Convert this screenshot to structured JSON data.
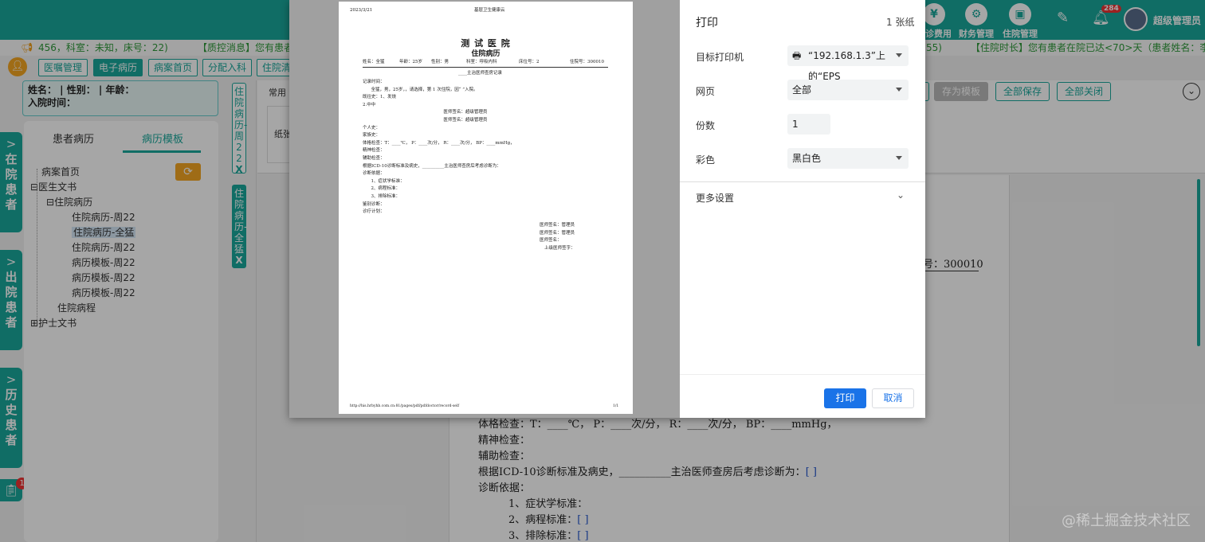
{
  "topbar": {
    "icons": [
      {
        "label": "门诊费用",
        "glyph": "¥",
        "icon": "yen-icon"
      },
      {
        "label": "财务管理",
        "glyph": "⚙",
        "icon": "gear-icon"
      },
      {
        "label": "住院管理",
        "glyph": "▣",
        "icon": "bed-icon"
      }
    ],
    "notify_count": "284",
    "user_name": "超级管理员"
  },
  "ticker": {
    "count": "456，科室：未知，床号：22)",
    "message": "【质控消息】您有患者",
    "mid": "55)",
    "message_right": "【住院时长】您有患者在院已达<70>天（患者姓名：李"
  },
  "nav": {
    "buttons": [
      "医嘱管理",
      "电子病历",
      "病案首页",
      "分配入科",
      "住院清"
    ],
    "active_index": 1
  },
  "patient": {
    "line1": "姓名：  | 性别：  | 年龄：",
    "line2": "入院时间："
  },
  "leftpanel": {
    "tabs": [
      "患者病历",
      "病历模板"
    ],
    "active_tab": 1,
    "tree": [
      {
        "label": "病案首页",
        "prefix": "",
        "level": 0
      },
      {
        "label": "医生文书",
        "prefix": "⊟",
        "level": 0
      },
      {
        "label": "住院病历",
        "prefix": "⊟",
        "level": 1
      },
      {
        "label": "住院病历-周22",
        "prefix": "",
        "level": 2
      },
      {
        "label": "住院病历-全猛",
        "prefix": "",
        "level": 2,
        "selected": true
      },
      {
        "label": "住院病历-周22",
        "prefix": "",
        "level": 2
      },
      {
        "label": "病历模板-周22",
        "prefix": "",
        "level": 2
      },
      {
        "label": "病历模板-周22",
        "prefix": "",
        "level": 2
      },
      {
        "label": "病历模板-周22",
        "prefix": "",
        "level": 2
      },
      {
        "label": "住院病程",
        "prefix": "",
        "level": 1
      },
      {
        "label": "护士文书",
        "prefix": "⊞",
        "level": 0
      }
    ]
  },
  "sidetabs": [
    {
      "label": "在院患者"
    },
    {
      "label": "出院患者"
    },
    {
      "label": "历史患者"
    }
  ],
  "sidebadge": "1",
  "vtabs": [
    {
      "label": "住院病历-周22",
      "close": "X"
    },
    {
      "label": "住院病历-全猛",
      "close": "X"
    }
  ],
  "toolbar": {
    "common": "常用",
    "paper_label": "纸张",
    "buttons": [
      "存为模板",
      "全部保存",
      "全部关闭"
    ]
  },
  "document": {
    "bed_no": "号：300010",
    "lines": [
      {
        "text": "体格检查：T：____℃， P：____次/分， R：____次/分， BP：____mmHg，",
        "indent": 0
      },
      {
        "text": "精神检查：",
        "indent": 0
      },
      {
        "text": "辅助检查：",
        "indent": 0
      },
      {
        "text": "根据ICD-10诊断标准及病史，__________主治医师查房后考虑诊断为：",
        "indent": 0,
        "blue": "[ ]"
      },
      {
        "text": "诊断依据：",
        "indent": 0
      },
      {
        "text": "1、症状学标准：",
        "indent": 1
      },
      {
        "text": "2、病程标准：",
        "indent": 1,
        "blue": "[ ]"
      },
      {
        "text": "3、排除标准：",
        "indent": 1,
        "blue": "[ ]"
      }
    ]
  },
  "print": {
    "title": "打印",
    "sheets": "1 张纸",
    "printer_label": "目标打印机",
    "printer_value": "“192.168.1.3”上的“EPS",
    "pages_label": "网页",
    "pages_value": "全部",
    "copies_label": "份数",
    "copies_value": "1",
    "color_label": "彩色",
    "color_value": "黑白色",
    "more": "更多设置",
    "print_btn": "打印",
    "cancel_btn": "取消"
  },
  "preview": {
    "date": "2023/3/21",
    "header_title": "基层卫生健康云",
    "hospital": "测 试 医 院",
    "doc_title": "住院病历",
    "info": [
      "姓名：全猛",
      "年龄：25岁",
      "性别：男",
      "科室：呼吸内科",
      "床位号：2",
      "住院号：300010"
    ],
    "section": "____主治医师查房记录",
    "body": [
      "记录时间：",
      "      全猛，男，25岁，，请选择，第 1 次住院，因“ ”入院。",
      "既往史：1、发烧",
      "2.中中",
      "                                                          医师签名：超级管理员",
      "                                                          医师签名：超级管理员",
      "个人史：",
      "家族史：",
      "体格检查：T：____℃， P：____次/分， R：____次/分， BP：____mmHg，",
      "精神检查：",
      "辅助检查：",
      "根据ICD-10诊断标准及病史，__________主治医师查房后考虑诊断为：",
      "诊断依据：",
      "      1、症状学标准：",
      "      2、病程标准：",
      "      3、排除标准：",
      "鉴别诊断：",
      "诊疗计划："
    ],
    "signs": [
      "医师签名：管理员",
      "医师签名：管理员",
      "医师签名：",
      "上级医师签字："
    ],
    "footer_url": "http://his.hrbyhb.com.cn:81/pages/pdf/pdfdoctor/record-self",
    "footer_page": "1/1"
  },
  "watermark": "@稀土掘金技术社区",
  "colors": {
    "accent": "#1aa89b",
    "print_blue": "#1a73e8"
  }
}
